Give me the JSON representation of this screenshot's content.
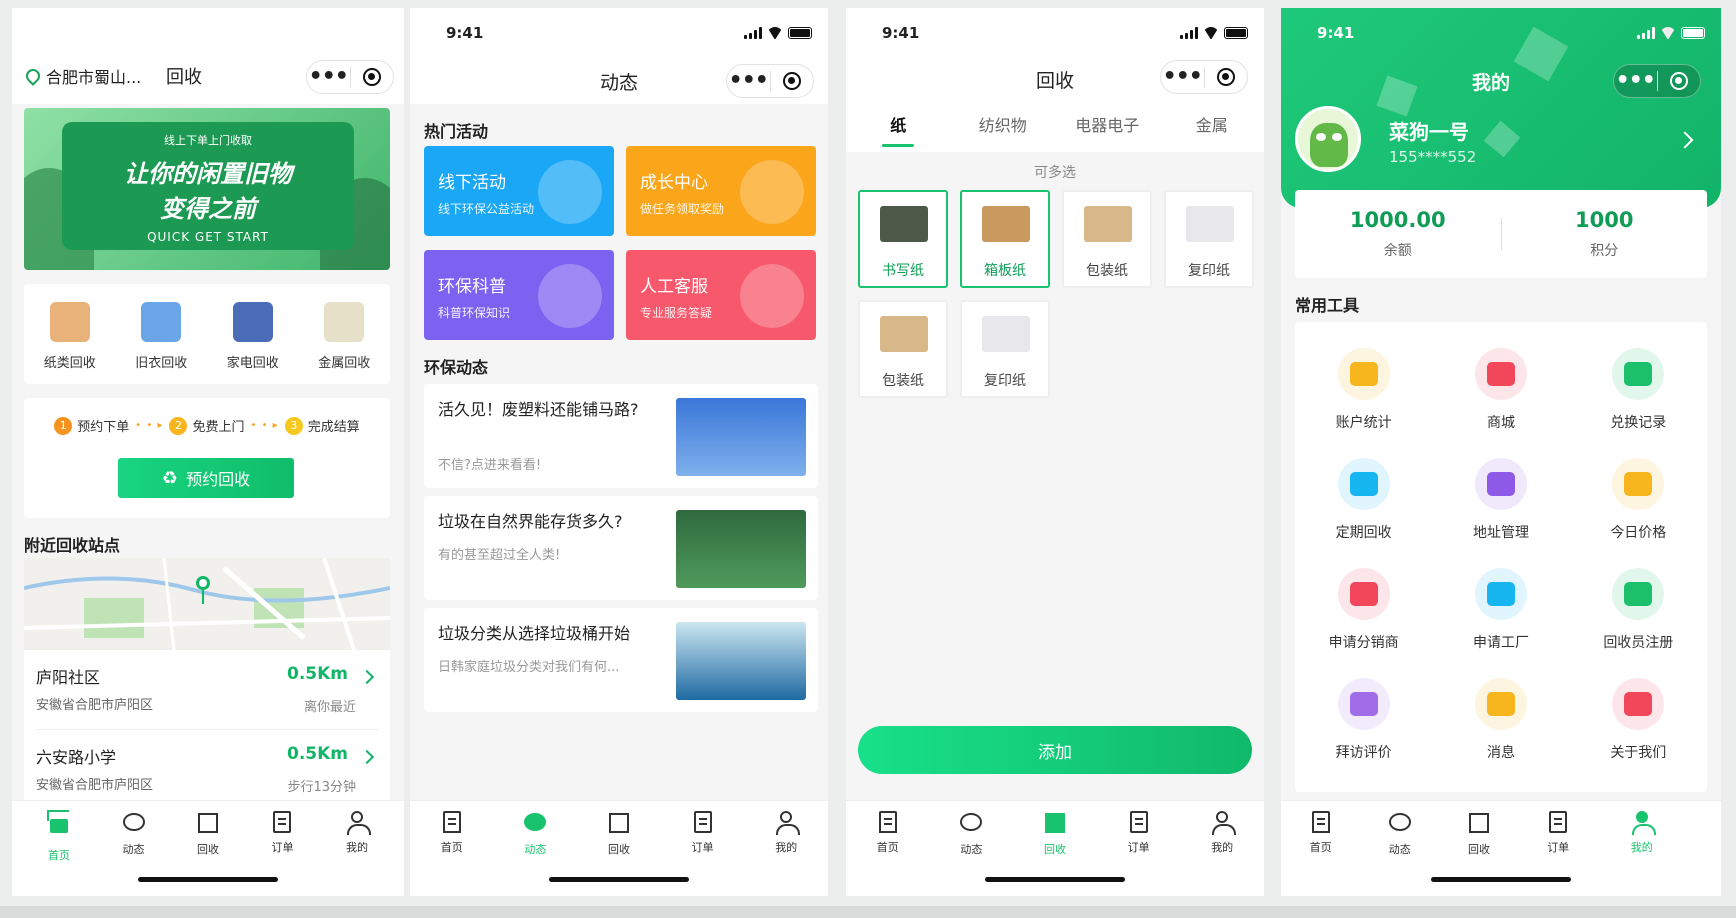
{
  "status_time": "9:41",
  "tabs": [
    "首页",
    "动态",
    "回收",
    "订单",
    "我的"
  ],
  "colors": {
    "accent": "#19c36d",
    "dark_green": "#0f8f4f"
  },
  "home": {
    "location": "合肥市蜀山...",
    "title": "回收",
    "banner": {
      "small": "线上下单上门收取",
      "line1": "让你的闲置旧物",
      "line2": "变得之前",
      "en": "QUICK GET START"
    },
    "categories": [
      {
        "label": "纸类回收",
        "icon": "cardboard-box-icon"
      },
      {
        "label": "旧衣回收",
        "icon": "clothes-basket-icon"
      },
      {
        "label": "家电回收",
        "icon": "tv-icon"
      },
      {
        "label": "金属回收",
        "icon": "metal-tube-icon"
      }
    ],
    "steps": [
      {
        "num": "1",
        "label": "预约下单"
      },
      {
        "num": "2",
        "label": "免费上门"
      },
      {
        "num": "3",
        "label": "完成结算"
      }
    ],
    "book_button": "预约回收",
    "nearby_title": "附近回收站点",
    "stations": [
      {
        "name": "庐阳社区",
        "addr": "安徽省合肥市庐阳区",
        "dist": "0.5Km",
        "note": "离你最近"
      },
      {
        "name": "六安路小学",
        "addr": "安徽省合肥市庐阳区",
        "dist": "0.5Km",
        "note": "步行13分钟"
      }
    ]
  },
  "news": {
    "title": "动态",
    "hot_title": "热门活动",
    "activities": [
      {
        "title": "线下活动",
        "sub": "线下环保公益活动",
        "color": "#1aa7f5"
      },
      {
        "title": "成长中心",
        "sub": "做任务领取奖励",
        "color": "#fba51a"
      },
      {
        "title": "环保科普",
        "sub": "科普环保知识",
        "color": "#7b62f0"
      },
      {
        "title": "人工客服",
        "sub": "专业服务答疑",
        "color": "#f7586b"
      }
    ],
    "feed_title": "环保动态",
    "articles": [
      {
        "title": "活久见！废塑料还能铺马路?",
        "sub": "不信?点进来看看!",
        "image": "city-skyline-image"
      },
      {
        "title": "垃圾在自然界能存货多久?",
        "sub": "有的甚至超过全人类!",
        "image": "forest-image"
      },
      {
        "title": "垃圾分类从选择垃圾桶开始",
        "sub": "日韩家庭垃圾分类对我们有何...",
        "image": "sea-image"
      }
    ]
  },
  "recycle": {
    "title": "回收",
    "categories": [
      "纸",
      "纺织物",
      "电器电子",
      "金属"
    ],
    "hint": "可多选",
    "items": [
      {
        "label": "书写纸",
        "selected": true
      },
      {
        "label": "箱板纸",
        "selected": true
      },
      {
        "label": "包装纸",
        "selected": false
      },
      {
        "label": "复印纸",
        "selected": false
      },
      {
        "label": "包装纸",
        "selected": false
      },
      {
        "label": "复印纸",
        "selected": false
      }
    ],
    "add_button": "添加"
  },
  "mine": {
    "title": "我的",
    "name": "菜狗一号",
    "phone": "155****552",
    "balance": "1000.00",
    "balance_label": "余额",
    "points": "1000",
    "points_label": "积分",
    "tools_title": "常用工具",
    "tools": [
      {
        "label": "账户统计",
        "icon": "account-card-icon",
        "color": "#f7b51e"
      },
      {
        "label": "商城",
        "icon": "shopping-cart-icon",
        "color": "#f2465a"
      },
      {
        "label": "兑换记录",
        "icon": "yuan-ticket-icon",
        "color": "#1cc06a"
      },
      {
        "label": "定期回收",
        "icon": "trash-bin-icon",
        "color": "#17b6f0"
      },
      {
        "label": "地址管理",
        "icon": "location-pin-icon",
        "color": "#8c5ae6"
      },
      {
        "label": "今日价格",
        "icon": "coins-stack-icon",
        "color": "#f7b51e"
      },
      {
        "label": "申请分销商",
        "icon": "org-chart-icon",
        "color": "#f2465a"
      },
      {
        "label": "申请工厂",
        "icon": "factory-icon",
        "color": "#17b6f0"
      },
      {
        "label": "回收员注册",
        "icon": "collector-badge-icon",
        "color": "#1cc06a"
      },
      {
        "label": "拜访评价",
        "icon": "flower-icon",
        "color": "#a06ce8"
      },
      {
        "label": "消息",
        "icon": "message-bubble-icon",
        "color": "#f7b51e"
      },
      {
        "label": "关于我们",
        "icon": "team-icon",
        "color": "#f2465a"
      }
    ]
  }
}
